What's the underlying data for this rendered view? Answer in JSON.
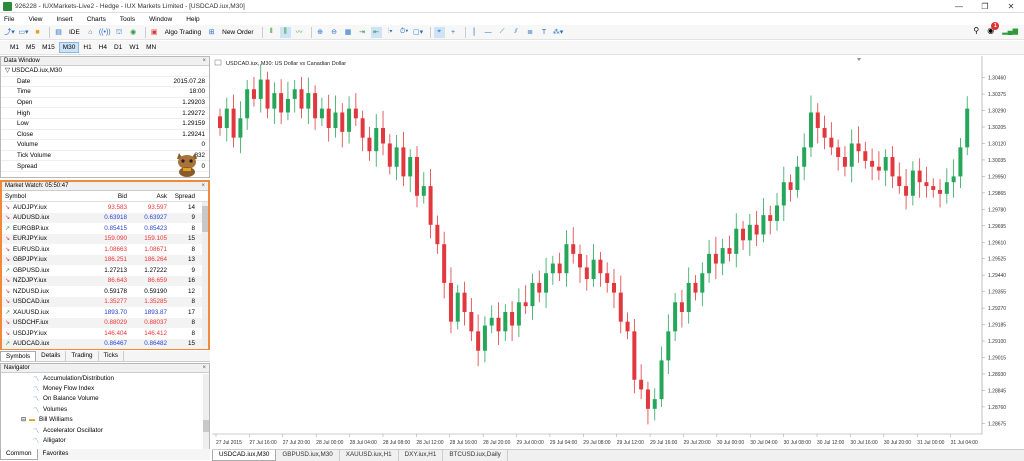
{
  "window": {
    "title": "926228 - IUXMarkets-Live2 - Hedge - IUX Markets Limited - [USDCAD.iux,M30]",
    "controls": [
      "—",
      "❐",
      "✕"
    ]
  },
  "menu": [
    "File",
    "View",
    "Insert",
    "Charts",
    "Tools",
    "Window",
    "Help"
  ],
  "toolbar": {
    "ide_label": "IDE",
    "algo_trading_label": "Algo Trading",
    "new_order_label": "New Order",
    "notification_count": "1"
  },
  "timeframes": [
    "M1",
    "M5",
    "M15",
    "M30",
    "H1",
    "H4",
    "D1",
    "W1",
    "MN"
  ],
  "active_timeframe": "M30",
  "data_window": {
    "header": "Data Window",
    "symbol": "USDCAD.iux,M30",
    "rows": [
      {
        "k": "Date",
        "v": "2015.07.28"
      },
      {
        "k": "Time",
        "v": "18:00"
      },
      {
        "k": "Open",
        "v": "1.29203"
      },
      {
        "k": "High",
        "v": "1.29272"
      },
      {
        "k": "Low",
        "v": "1.29159"
      },
      {
        "k": "Close",
        "v": "1.29241"
      },
      {
        "k": "Volume",
        "v": "0"
      },
      {
        "k": "Tick Volume",
        "v": "832"
      },
      {
        "k": "Spread",
        "v": "0"
      }
    ]
  },
  "market_watch": {
    "header": "Market Watch: 05:50:47",
    "columns": [
      "Symbol",
      "Bid",
      "Ask",
      "Spread"
    ],
    "rows": [
      {
        "s": "AUDJPY.iux",
        "bid": "93.583",
        "ask": "93.597",
        "sp": "14",
        "dir": "down",
        "color": "red"
      },
      {
        "s": "AUDUSD.iux",
        "bid": "0.63918",
        "ask": "0.63927",
        "sp": "9",
        "dir": "down",
        "color": "blue"
      },
      {
        "s": "EURGBP.iux",
        "bid": "0.85415",
        "ask": "0.85423",
        "sp": "8",
        "dir": "up",
        "color": "blue"
      },
      {
        "s": "EURJPY.iux",
        "bid": "159.090",
        "ask": "159.105",
        "sp": "15",
        "dir": "down",
        "color": "red"
      },
      {
        "s": "EURUSD.iux",
        "bid": "1.08663",
        "ask": "1.08671",
        "sp": "8",
        "dir": "down",
        "color": "red"
      },
      {
        "s": "GBPJPY.iux",
        "bid": "186.251",
        "ask": "186.264",
        "sp": "13",
        "dir": "down",
        "color": "red"
      },
      {
        "s": "GBPUSD.iux",
        "bid": "1.27213",
        "ask": "1.27222",
        "sp": "9",
        "dir": "up",
        "color": "black"
      },
      {
        "s": "NZDJPY.iux",
        "bid": "86.643",
        "ask": "86.659",
        "sp": "16",
        "dir": "down",
        "color": "red"
      },
      {
        "s": "NZDUSD.iux",
        "bid": "0.59178",
        "ask": "0.59190",
        "sp": "12",
        "dir": "down",
        "color": "black"
      },
      {
        "s": "USDCAD.iux",
        "bid": "1.35277",
        "ask": "1.35285",
        "sp": "8",
        "dir": "down",
        "color": "red"
      },
      {
        "s": "XAUUSD.iux",
        "bid": "1893.70",
        "ask": "1893.87",
        "sp": "17",
        "dir": "up",
        "color": "blue"
      },
      {
        "s": "USDCHF.iux",
        "bid": "0.88029",
        "ask": "0.88037",
        "sp": "8",
        "dir": "down",
        "color": "red"
      },
      {
        "s": "USDJPY.iux",
        "bid": "146.404",
        "ask": "146.412",
        "sp": "8",
        "dir": "down",
        "color": "red"
      },
      {
        "s": "AUDCAD.iux",
        "bid": "0.86467",
        "ask": "0.86482",
        "sp": "15",
        "dir": "up",
        "color": "blue"
      }
    ],
    "tabs": [
      "Symbols",
      "Details",
      "Trading",
      "Ticks"
    ]
  },
  "navigator": {
    "header": "Navigator",
    "items": [
      {
        "label": "Accumulation/Distribution",
        "icon": "indicator-icon",
        "indent": 2
      },
      {
        "label": "Money Flow Index",
        "icon": "indicator-icon",
        "indent": 2
      },
      {
        "label": "On Balance Volume",
        "icon": "indicator-icon",
        "indent": 2
      },
      {
        "label": "Volumes",
        "icon": "indicator-icon",
        "indent": 2
      },
      {
        "label": "Bill Williams",
        "icon": "folder-icon",
        "indent": 1
      },
      {
        "label": "Accelerator Oscillator",
        "icon": "indicator-icon",
        "indent": 2
      },
      {
        "label": "Alligator",
        "icon": "indicator-icon",
        "indent": 2
      }
    ],
    "tabs": [
      "Common",
      "Favorites"
    ]
  },
  "chart": {
    "label": "USDCAD.iux, M30:  US Dollar vs Canadian Dollar",
    "tabs": [
      "USDCAD.iux,M30",
      "GBPUSD.iux,M30",
      "XAUUSD.iux,H1",
      "DXY.iux,H1",
      "BTCUSD.iux,Daily"
    ],
    "colors": {
      "up": "#26a65b",
      "down": "#e0383d"
    }
  },
  "chart_data": {
    "type": "candlestick",
    "title": "USDCAD.iux, M30:  US Dollar vs Canadian Dollar",
    "y_ticks": [
      "1.30460",
      "1.30375",
      "1.30290",
      "1.30205",
      "1.30120",
      "1.30035",
      "1.29950",
      "1.29865",
      "1.29780",
      "1.29695",
      "1.29610",
      "1.29525",
      "1.29440",
      "1.29355",
      "1.29270",
      "1.29185",
      "1.29100",
      "1.29015",
      "1.28930",
      "1.28845",
      "1.28760",
      "1.28675"
    ],
    "ylim": [
      1.2862,
      1.3052
    ],
    "x_ticks": [
      "27 Jul 2015",
      "27 Jul 16:00",
      "27 Jul 20:00",
      "28 Jul 00:00",
      "28 Jul 04:00",
      "28 Jul 08:00",
      "28 Jul 12:00",
      "28 Jul 16:00",
      "28 Jul 20:00",
      "29 Jul 00:00",
      "29 Jul 04:00",
      "29 Jul 08:00",
      "29 Jul 12:00",
      "29 Jul 16:00",
      "29 Jul 20:00",
      "30 Jul 00:00",
      "30 Jul 04:00",
      "30 Jul 08:00",
      "30 Jul 12:00",
      "30 Jul 16:00",
      "30 Jul 20:00",
      "31 Jul 00:00",
      "31 Jul 04:00"
    ],
    "closes": [
      1.302,
      1.303,
      1.3015,
      1.3025,
      1.304,
      1.3035,
      1.3045,
      1.303,
      1.3038,
      1.3028,
      1.3035,
      1.304,
      1.303,
      1.3038,
      1.3025,
      1.303,
      1.302,
      1.3028,
      1.3018,
      1.303,
      1.3025,
      1.3015,
      1.3008,
      1.302,
      1.3012,
      1.3,
      1.301,
      1.2995,
      1.3005,
      1.2985,
      1.299,
      1.297,
      1.296,
      1.294,
      1.292,
      1.2935,
      1.2925,
      1.2915,
      1.2905,
      1.2918,
      1.2922,
      1.2915,
      1.2925,
      1.2918,
      1.293,
      1.2928,
      1.294,
      1.2935,
      1.2945,
      1.295,
      1.2945,
      1.296,
      1.2955,
      1.2948,
      1.2942,
      1.2952,
      1.2945,
      1.294,
      1.2935,
      1.292,
      1.2915,
      1.289,
      1.2885,
      1.2875,
      1.288,
      1.29,
      1.2915,
      1.293,
      1.2925,
      1.294,
      1.2935,
      1.2945,
      1.2955,
      1.295,
      1.2958,
      1.2955,
      1.2968,
      1.2962,
      1.297,
      1.2965,
      1.2975,
      1.2972,
      1.298,
      1.2992,
      1.2988,
      1.3,
      1.301,
      1.3028,
      1.302,
      1.3015,
      1.301,
      1.3005,
      1.3,
      1.3012,
      1.3008,
      1.3003,
      1.3,
      1.2998,
      1.3005,
      1.2995,
      1.299,
      1.2985,
      1.2998,
      1.2992,
      1.299,
      1.2988,
      1.2986,
      1.2992,
      1.2995,
      1.301,
      1.303
    ]
  }
}
